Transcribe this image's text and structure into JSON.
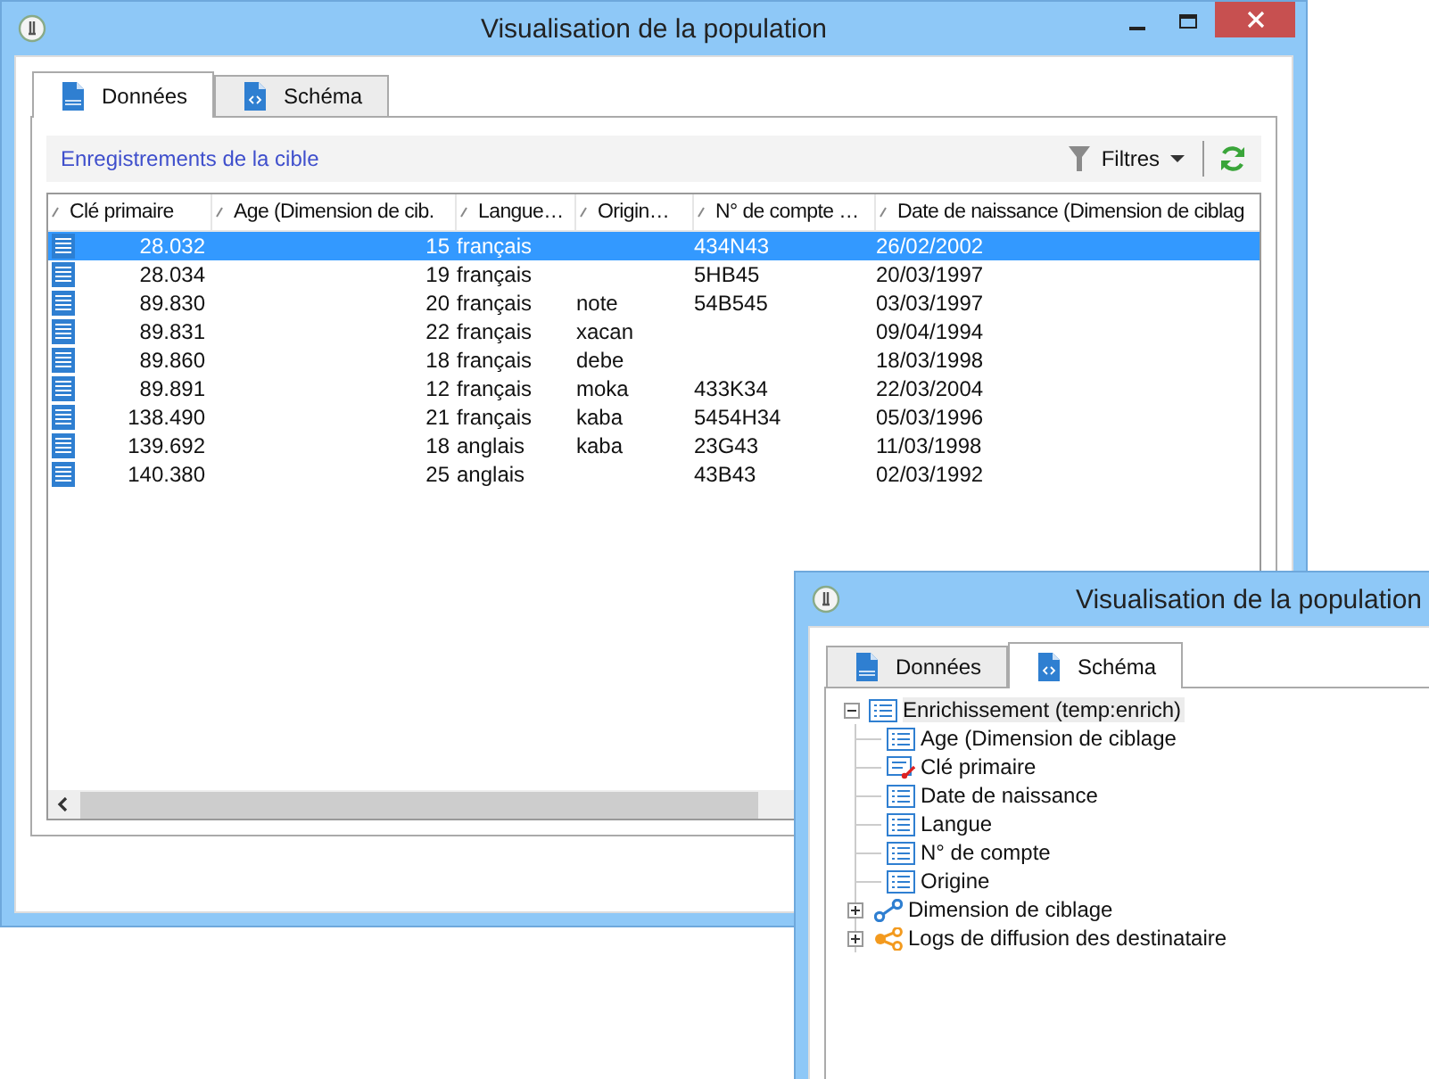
{
  "main_window": {
    "title": "Visualisation de la population",
    "tabs": [
      {
        "label": "Données",
        "kind": "sql",
        "selected": true
      },
      {
        "label": "Schéma",
        "kind": "code",
        "selected": false
      }
    ],
    "toolbar": {
      "title": "Enregistrements de la cible",
      "filter_label": "Filtres"
    },
    "table": {
      "columns": [
        "Clé primaire",
        "Age (Dimension de cib.",
        "Langue…",
        "Origin…",
        "N° de compte …",
        "Date de naissance (Dimension de ciblag"
      ],
      "rows": [
        {
          "selected": true,
          "cells": [
            "28.032",
            "15",
            "français",
            "",
            "434N43",
            "26/02/2002"
          ]
        },
        {
          "selected": false,
          "cells": [
            "28.034",
            "19",
            "français",
            "",
            "5HB45",
            "20/03/1997"
          ]
        },
        {
          "selected": false,
          "cells": [
            "89.830",
            "20",
            "français",
            "note",
            "54B545",
            "03/03/1997"
          ]
        },
        {
          "selected": false,
          "cells": [
            "89.831",
            "22",
            "français",
            "xacan",
            "",
            "09/04/1994"
          ]
        },
        {
          "selected": false,
          "cells": [
            "89.860",
            "18",
            "français",
            "debe",
            "",
            "18/03/1998"
          ]
        },
        {
          "selected": false,
          "cells": [
            "89.891",
            "12",
            "français",
            "moka",
            "433K34",
            "22/03/2004"
          ]
        },
        {
          "selected": false,
          "cells": [
            "138.490",
            "21",
            "français",
            "kaba",
            "5454H34",
            "05/03/1996"
          ]
        },
        {
          "selected": false,
          "cells": [
            "139.692",
            "18",
            "anglais",
            "kaba",
            "23G43",
            "11/03/1998"
          ]
        },
        {
          "selected": false,
          "cells": [
            "140.380",
            "25",
            "anglais",
            "",
            "43B43",
            "02/03/1992"
          ]
        }
      ]
    }
  },
  "schema_window": {
    "title": "Visualisation de la population",
    "tabs": [
      {
        "label": "Données",
        "kind": "sql",
        "selected": false
      },
      {
        "label": "Schéma",
        "kind": "code",
        "selected": true
      }
    ],
    "tree": [
      {
        "label": "Enrichissement (temp:enrich)",
        "kind": "table",
        "expanded": true,
        "selected": true,
        "children": [
          {
            "label": "Age (Dimension de ciblage",
            "kind": "field"
          },
          {
            "label": "Clé primaire",
            "kind": "key"
          },
          {
            "label": "Date de naissance",
            "kind": "field"
          },
          {
            "label": "Langue",
            "kind": "field"
          },
          {
            "label": "N° de compte",
            "kind": "field"
          },
          {
            "label": "Origine",
            "kind": "field"
          },
          {
            "label": "Dimension de ciblage",
            "kind": "link",
            "expanded": false
          },
          {
            "label": "Logs de diffusion des destinataire",
            "kind": "links",
            "expanded": false
          }
        ]
      }
    ]
  }
}
